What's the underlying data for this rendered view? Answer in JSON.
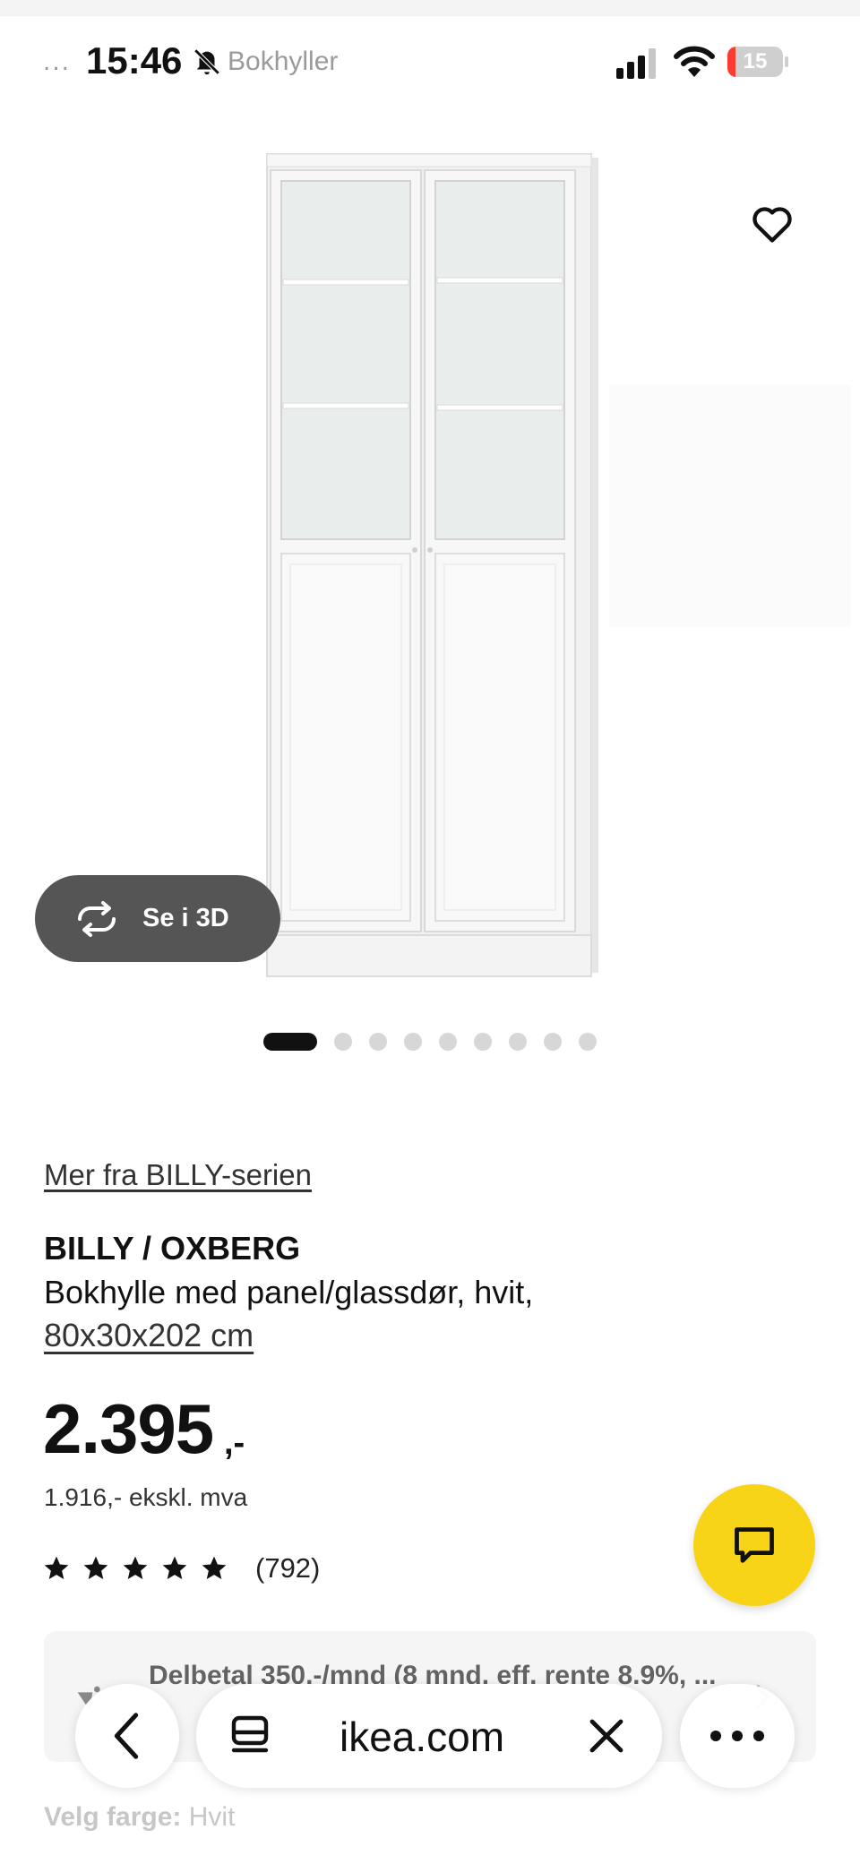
{
  "status_bar": {
    "dots": "...",
    "time": "15:46",
    "breadcrumb": "Bokhyller",
    "battery_level": "15",
    "battery_fraction": 0.15
  },
  "product": {
    "see_3d_label": "Se i 3D",
    "image_count": 9,
    "active_image": 1,
    "series_link": "Mer fra BILLY-serien",
    "name": "BILLY / OXBERG",
    "description": "Bokhylle med panel/glassdør, hvit,",
    "size": "80x30x202 cm",
    "price": "2.395",
    "price_suffix": ",-",
    "price_excl_vat": "1.916,- ekskl. mva",
    "rating_stars": 5,
    "review_count": "(792)"
  },
  "finance": {
    "text": "Delbetal 350,-/mnd (8 mnd. eff. rente 8.9%, ..."
  },
  "color": {
    "label": "Velg farge:",
    "value": "Hvit"
  },
  "browser": {
    "url": "ikea.com"
  },
  "colors": {
    "accent_yellow": "#f7d417",
    "pill_dark": "#555555",
    "battery_red": "#ff3b30"
  }
}
